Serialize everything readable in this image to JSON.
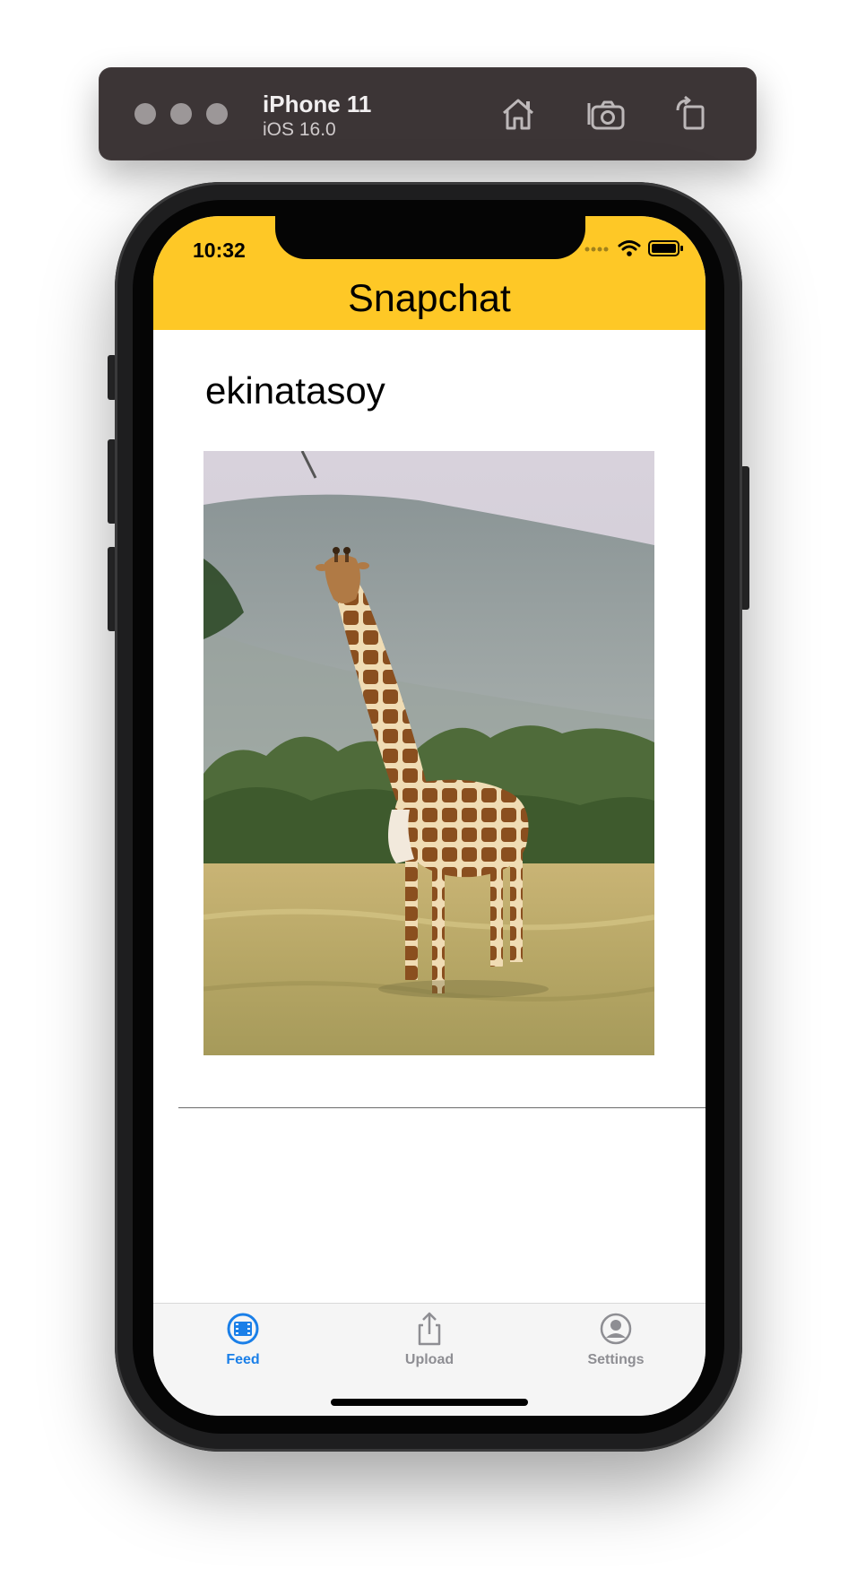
{
  "simulator": {
    "device_name": "iPhone 11",
    "os_version": "iOS 16.0",
    "icons": [
      "home-icon",
      "screenshot-camera-icon",
      "rotate-device-icon"
    ]
  },
  "status_bar": {
    "time": "10:32"
  },
  "app": {
    "title": "Snapchat",
    "accent_color": "#fec826"
  },
  "post": {
    "username": "ekinatasoy",
    "image_subject": "giraffe standing in savanna grass"
  },
  "tabbar": {
    "tabs": [
      {
        "label": "Feed",
        "icon": "film-icon",
        "selected": true
      },
      {
        "label": "Upload",
        "icon": "share-upload-icon",
        "selected": false
      },
      {
        "label": "Settings",
        "icon": "person-circle-icon",
        "selected": false
      }
    ],
    "selected_color": "#1a7fe8",
    "unselected_color": "#8e8e93"
  }
}
